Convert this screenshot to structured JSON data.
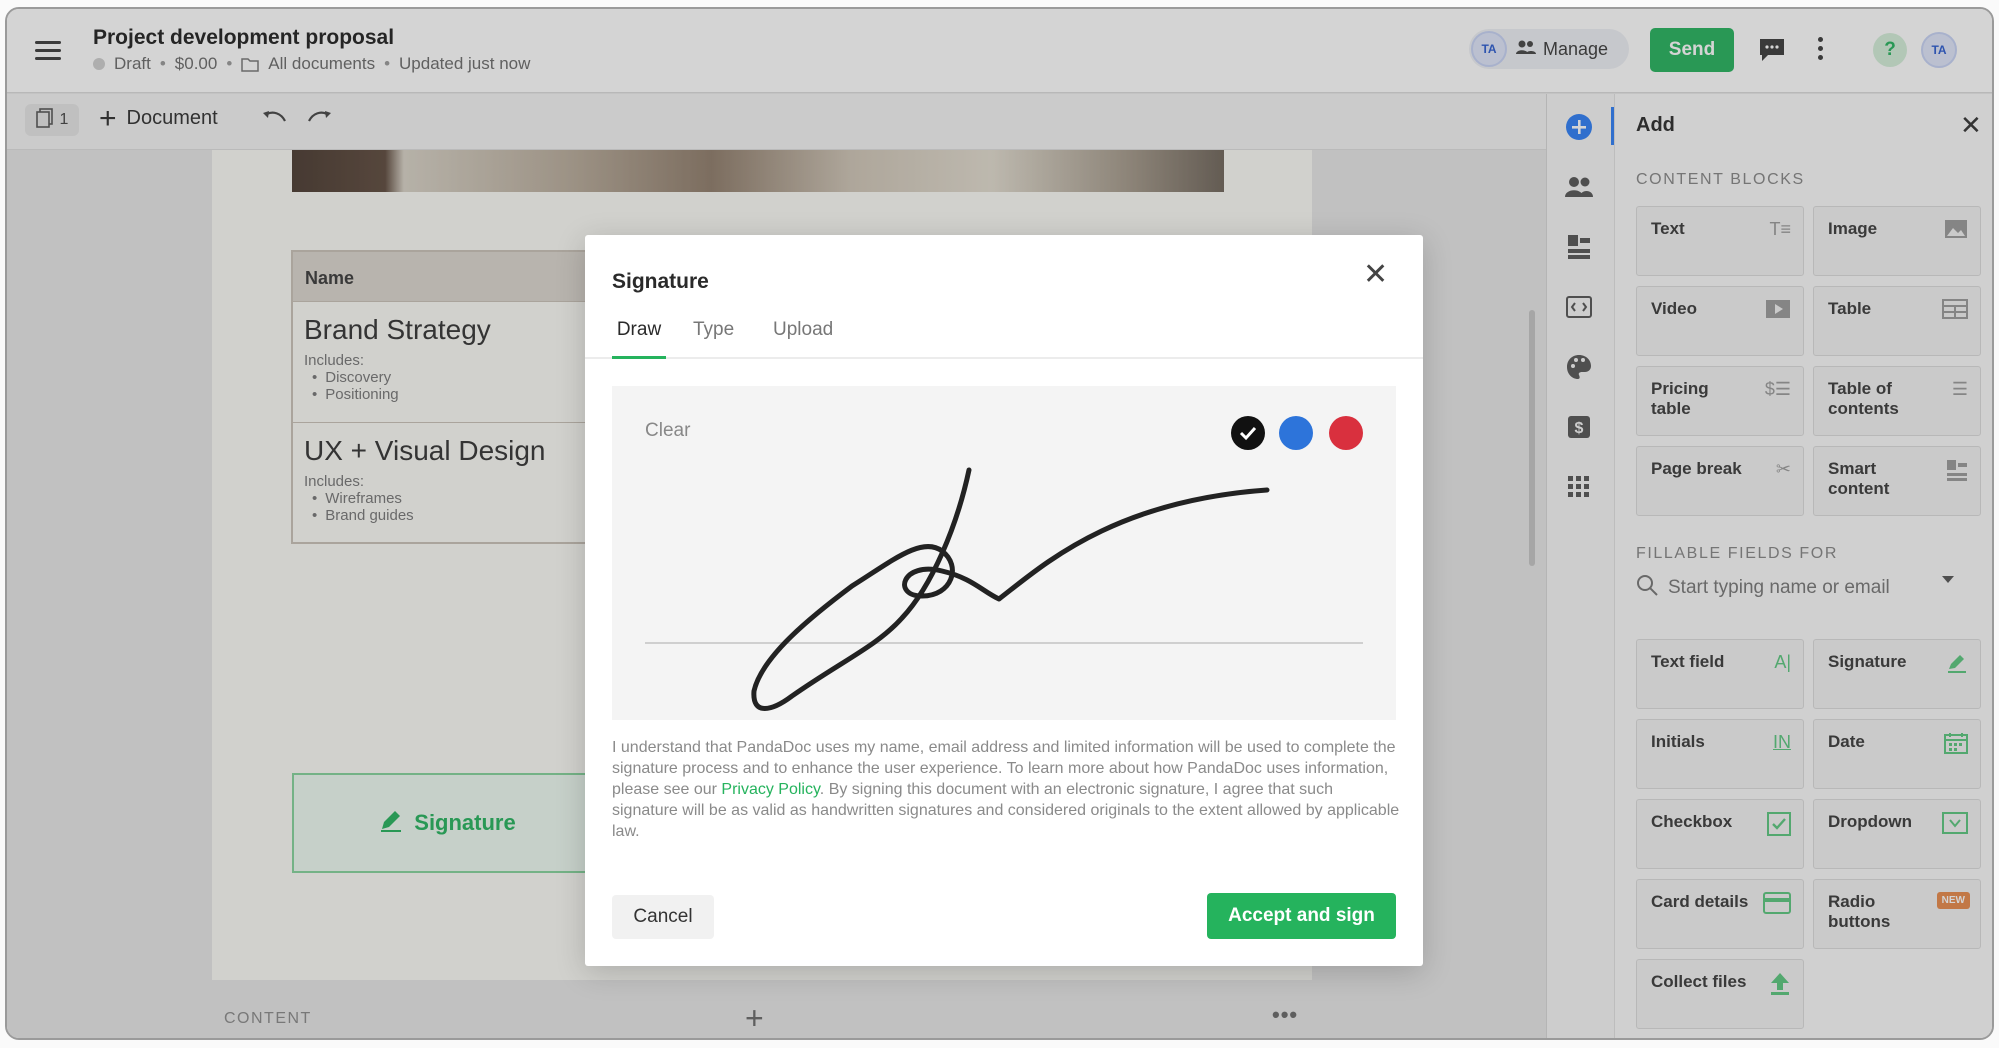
{
  "header": {
    "title": "Project development proposal",
    "status": "Draft",
    "amount": "$0.00",
    "folder": "All documents",
    "updated": "Updated just now",
    "manage_label": "Manage",
    "avatar_initials": "TA",
    "send_label": "Send",
    "help_label": "?"
  },
  "toolbar": {
    "page_count": "1",
    "add_document_label": "Document"
  },
  "document": {
    "table_header": "Name",
    "services": [
      {
        "title": "Brand Strategy",
        "includes_label": "Includes:",
        "items": [
          "Discovery",
          "Positioning"
        ]
      },
      {
        "title": "UX + Visual Design",
        "includes_label": "Includes:",
        "items": [
          "Wireframes",
          "Brand guides"
        ]
      }
    ],
    "signature_field_label": "Signature",
    "content_label": "CONTENT"
  },
  "modal": {
    "title": "Signature",
    "tabs": [
      "Draw",
      "Type",
      "Upload"
    ],
    "active_tab": "Draw",
    "clear_label": "Clear",
    "ink_colors": [
      "#111111",
      "#2d74da",
      "#d9303e"
    ],
    "selected_ink": "#111111",
    "consent_before": "I understand that PandaDoc uses my name, email address and limited information will be used to complete the signature process and to enhance the user experience. To learn more about how PandaDoc uses information, please see our ",
    "consent_link": "Privacy Policy",
    "consent_after": ". By signing this document with an electronic signature, I agree that such signature will be as valid as handwritten signatures and considered originals to the extent allowed by applicable law.",
    "cancel_label": "Cancel",
    "accept_label": "Accept and sign"
  },
  "panel": {
    "title": "Add",
    "content_blocks_label": "CONTENT BLOCKS",
    "content_blocks": [
      {
        "label": "Text",
        "icon": "text-icon"
      },
      {
        "label": "Image",
        "icon": "image-icon"
      },
      {
        "label": "Video",
        "icon": "video-icon"
      },
      {
        "label": "Table",
        "icon": "table-icon"
      },
      {
        "label": "Pricing table",
        "icon": "pricing-table-icon"
      },
      {
        "label": "Table of contents",
        "icon": "toc-icon"
      },
      {
        "label": "Page break",
        "icon": "scissors-icon"
      },
      {
        "label": "Smart content",
        "icon": "smart-content-icon"
      }
    ],
    "fillable_label": "FILLABLE FIELDS FOR",
    "search_placeholder": "Start typing name or email",
    "fields": [
      {
        "label": "Text field",
        "icon": "text-field-icon"
      },
      {
        "label": "Signature",
        "icon": "pen-icon"
      },
      {
        "label": "Initials",
        "icon": "initials-icon"
      },
      {
        "label": "Date",
        "icon": "calendar-icon"
      },
      {
        "label": "Checkbox",
        "icon": "checkbox-icon"
      },
      {
        "label": "Dropdown",
        "icon": "dropdown-icon"
      },
      {
        "label": "Card details",
        "icon": "card-icon"
      },
      {
        "label": "Radio buttons",
        "icon": "radio-icon",
        "badge": "NEW"
      },
      {
        "label": "Collect files",
        "icon": "upload-icon"
      }
    ],
    "initials_icon_text": "IN",
    "text_field_icon_text": "A|"
  },
  "colors": {
    "accent_green": "#25b35d",
    "accent_blue": "#2d7ef7"
  }
}
